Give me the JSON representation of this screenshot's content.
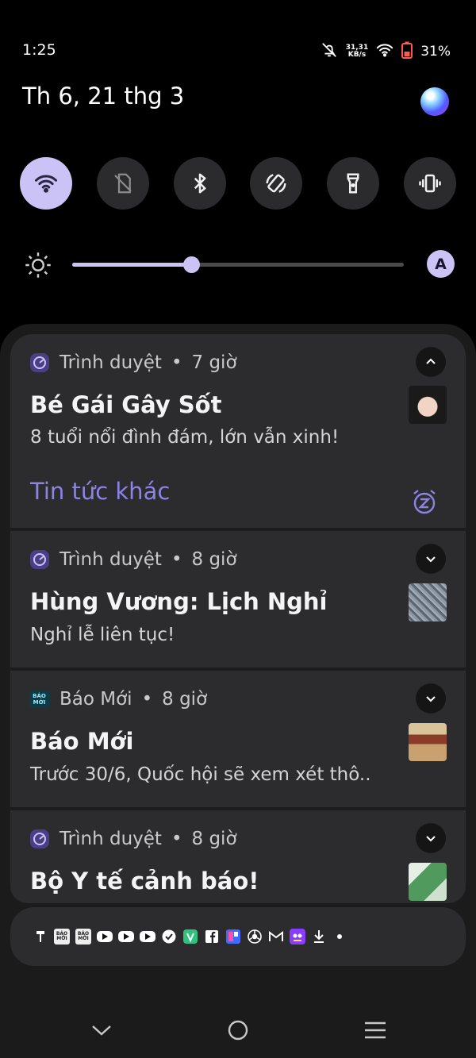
{
  "status_bar": {
    "time": "1:25",
    "net_speed_value": "31,31",
    "net_speed_unit": "KB/s",
    "battery": "31%",
    "icons": [
      "mute-icon",
      "wifi-icon",
      "battery-icon"
    ]
  },
  "header": {
    "date": "Th 6, 21 thg 3"
  },
  "quick_toggles": [
    {
      "name": "wifi",
      "icon": "wifi-icon",
      "active": true
    },
    {
      "name": "mobile-data",
      "icon": "no-sim-icon",
      "active": false
    },
    {
      "name": "bluetooth",
      "icon": "bluetooth-icon",
      "active": false
    },
    {
      "name": "auto-rotate",
      "icon": "rotate-icon",
      "active": false
    },
    {
      "name": "flashlight",
      "icon": "flashlight-icon",
      "active": false
    },
    {
      "name": "vibrate",
      "icon": "vibrate-icon",
      "active": false
    }
  ],
  "brightness": {
    "level": 0.36,
    "auto_label": "A"
  },
  "notifications": [
    {
      "app": "Trình duyệt",
      "time": "7 giờ",
      "title": "Bé Gái Gây Sốt",
      "body": "8 tuổi nổi đình đám, lớn vẫn xinh!",
      "action": "Tin tức khác",
      "expanded": true
    },
    {
      "app": "Trình duyệt",
      "time": "8 giờ",
      "title": "Hùng Vương: Lịch Nghỉ",
      "body": "Nghỉ lễ liên tục!",
      "expanded": false
    },
    {
      "app": "Báo Mới",
      "time": "8 giờ",
      "title": "Báo Mới",
      "body": "Trước 30/6, Quốc hội sẽ xem xét thô..",
      "expanded": false
    },
    {
      "app": "Trình duyệt",
      "time": "8 giờ",
      "title": "Bộ Y tế cảnh báo!",
      "expanded": false
    }
  ],
  "separator": "•",
  "baomoi_icon_text": "BÁO MỚI",
  "overflow_icons": [
    "usb-icon",
    "baomoi-icon",
    "baomoi-icon",
    "youtube-icon",
    "youtube-icon",
    "youtube-icon",
    "check-icon",
    "vpn-icon",
    "facebook-icon",
    "app-icon",
    "chrome-icon",
    "gmail-icon",
    "game-icon",
    "download-icon"
  ],
  "colors": {
    "accent": "#cbc3f5",
    "card": "#2c2c2e",
    "action": "#8d82e6"
  }
}
